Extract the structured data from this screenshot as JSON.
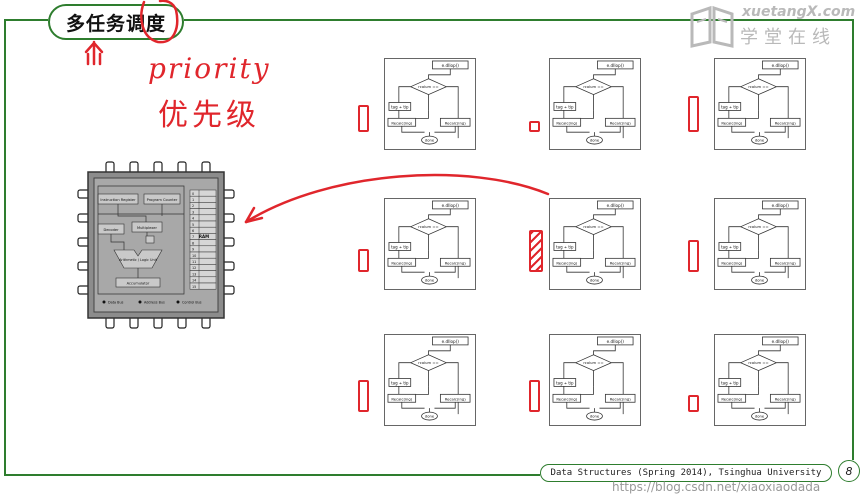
{
  "slide": {
    "title": "多任务调度",
    "footer_text": "Data Structures (Spring 2014), Tsinghua University",
    "page_number": "8"
  },
  "brand": {
    "logo_en": "xuetangX.com",
    "logo_cn": "学堂在线"
  },
  "annotations": {
    "priority_en": "priority",
    "priority_cn": "优先级",
    "up_arrow": "↑"
  },
  "watermark": "https://blog.csdn.net/xiaoxiaodada",
  "cpu": {
    "labels": {
      "instruction_register": "Instruction Register",
      "program_counter": "Program Counter",
      "decoder": "Decoder",
      "multiplexer": "Multiplexer",
      "alu": "Arithmetic / Logic Unit",
      "accumulator": "Accumulator",
      "ram": "RAM",
      "data_bus": "Data Bus",
      "address_bus": "Address Bus",
      "control_bus": "Control Bus"
    },
    "ram_rows": [
      "0",
      "1",
      "2",
      "3",
      "4",
      "5",
      "6",
      "7",
      "8",
      "9",
      "10",
      "11",
      "12",
      "13",
      "14",
      "15"
    ]
  },
  "flowchart": {
    "start": "e.dllop()",
    "decision": "rcolum ==",
    "process_left": "tag ÷ tip",
    "box_left": "Recalc(ing)",
    "box_right": "Recalc(ing)",
    "end": "done"
  },
  "colors": {
    "frame_green": "#2e7d2e",
    "annotation_red": "#e0262c",
    "chip_body": "#8c8c8c",
    "chip_inner": "#a8a8a8"
  },
  "tasks": [
    {
      "priority_level": 0.65,
      "hatched": false
    },
    {
      "priority_level": 0.25,
      "hatched": false
    },
    {
      "priority_level": 0.85,
      "hatched": false
    },
    {
      "priority_level": 0.55,
      "hatched": false
    },
    {
      "priority_level": 1.0,
      "hatched": true
    },
    {
      "priority_level": 0.75,
      "hatched": false
    },
    {
      "priority_level": 0.75,
      "hatched": false
    },
    {
      "priority_level": 0.75,
      "hatched": false
    },
    {
      "priority_level": 0.4,
      "hatched": false
    }
  ]
}
